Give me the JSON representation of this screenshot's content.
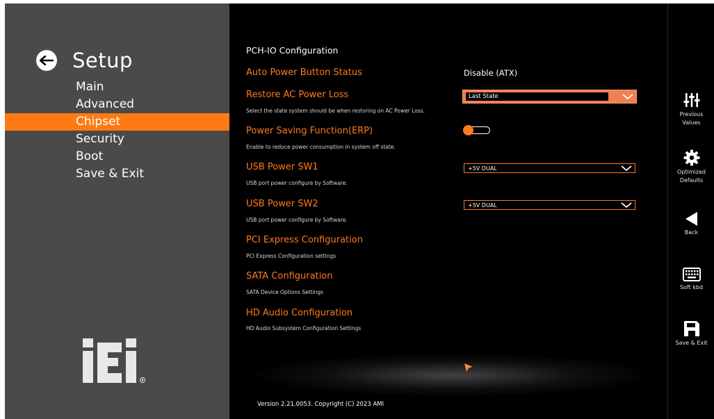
{
  "sidebar": {
    "title": "Setup",
    "menu": [
      {
        "label": "Main"
      },
      {
        "label": "Advanced"
      },
      {
        "label": "Chipset",
        "active": true
      },
      {
        "label": "Security"
      },
      {
        "label": "Boot"
      },
      {
        "label": "Save & Exit"
      }
    ]
  },
  "main": {
    "page_title": "PCH-IO Configuration",
    "rows": {
      "auto_power": {
        "label": "Auto Power Button Status",
        "value": "Disable (ATX)"
      },
      "restore_ac": {
        "label": "Restore AC Power Loss",
        "help": "Select the state system should be when restoring on AC Power Loss.",
        "value": "Last State"
      },
      "erp": {
        "label": "Power Saving Function(ERP)",
        "help": "Enable to reduce power consumption in system off state.",
        "enabled": false
      },
      "usb_sw1": {
        "label": "USB Power SW1",
        "help": "USB port power configure by Software.",
        "value": "+5V DUAL"
      },
      "usb_sw2": {
        "label": "USB Power SW2",
        "help": "USB port power configure by Software.",
        "value": "+5V DUAL"
      },
      "pci": {
        "label": "PCI Express Configuration",
        "help": "PCI Express Configuration settings"
      },
      "sata": {
        "label": "SATA Configuration",
        "help": "SATA Device Options Settings"
      },
      "hda": {
        "label": "HD Audio Configuration",
        "help": "HD Audio Subsystem Configuration Settings"
      }
    },
    "version": "Version 2.21.0053. Copyright (C) 2023 AMI"
  },
  "toolbar": {
    "previous": "Previous\nValues",
    "optimized": "Optimized\nDefaults",
    "back": "Back",
    "softkbd": "Soft kbd",
    "save_exit": "Save & Exit"
  },
  "colors": {
    "accent": "#ff7a1f",
    "sidebar_bg": "#4a4a4a",
    "active_item": "#ff7a12",
    "main_bg": "#000000"
  }
}
